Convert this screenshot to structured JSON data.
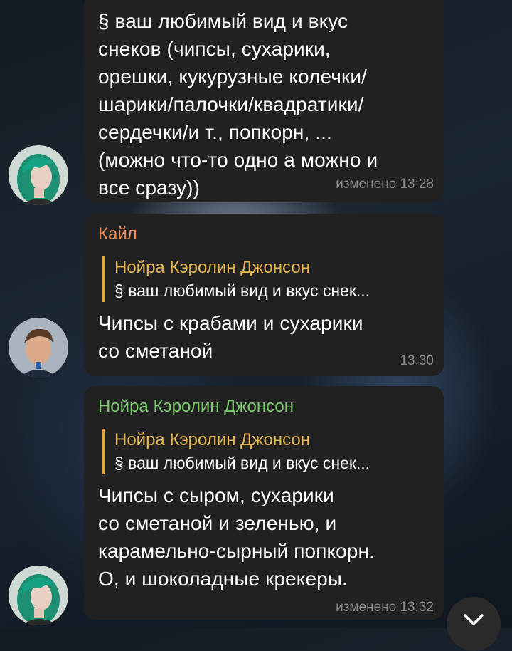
{
  "messages": [
    {
      "text": "§ ваш любимый вид и вкус\nснеков (чипсы, сухарики,\nорешки, кукурузные колечки/\nшарики/палочки/квадратики/\nсердечки/и т., попкорн, ...\n(можно что-то одно а можно и\nвсе сразу))",
      "meta": "изменено 13:28"
    },
    {
      "sender": "Кайл",
      "sender_color": "#f08e5a",
      "reply_name": "Нойра Кэролин Джонсон",
      "reply_text": "§ ваш любимый вид и вкус снек...",
      "text": "Чипсы с крабами и сухарики\nсо сметаной",
      "meta": "13:30"
    },
    {
      "sender": "Нойра Кэролин Джонсон",
      "sender_color": "#7cc96e",
      "reply_name": "Нойра Кэролин Джонсон",
      "reply_text": "§ ваш любимый вид и вкус снек...",
      "text": "Чипсы с сыром, сухарики\nсо сметаной и зеленью, и\nкарамельно-сырный попкорн.\nО, и шоколадные крекеры.",
      "meta": "изменено 13:32"
    }
  ],
  "icons": {
    "avatar_1": "avatar-green-hair-icon",
    "avatar_2": "avatar-man-icon",
    "avatar_3": "avatar-green-hair-icon",
    "scroll": "chevron-down-icon"
  }
}
